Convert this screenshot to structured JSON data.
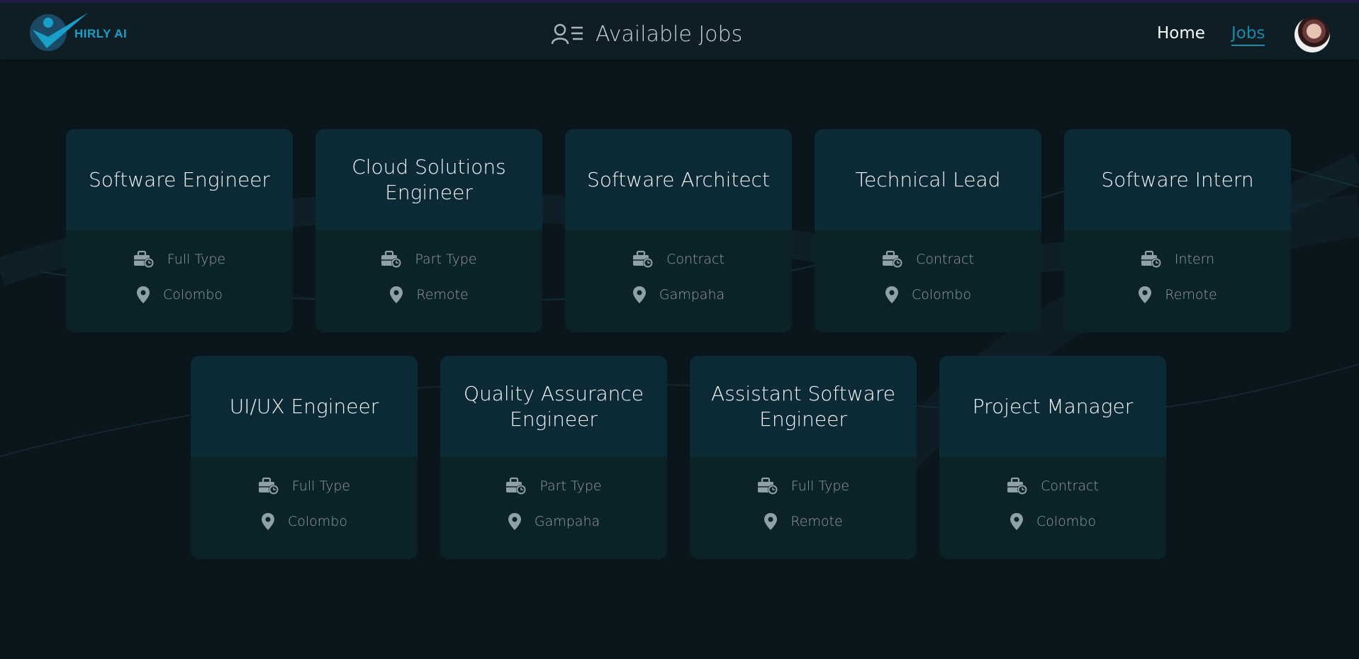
{
  "brand": {
    "name": "HIRLY AI"
  },
  "header": {
    "title": "Available Jobs",
    "title_icon": "user-list-icon"
  },
  "nav": {
    "home_label": "Home",
    "jobs_label": "Jobs"
  },
  "colors": {
    "accent": "#1b88a8",
    "background": "#0b161c",
    "card": "#0b2229",
    "card_header": "#0b2a35"
  },
  "jobs": [
    {
      "title": "Software Engineer",
      "type": "Full Type",
      "location": "Colombo"
    },
    {
      "title": "Cloud Solutions Engineer",
      "type": "Part Type",
      "location": "Remote"
    },
    {
      "title": "Software Architect",
      "type": "Contract",
      "location": "Gampaha"
    },
    {
      "title": "Technical Lead",
      "type": "Contract",
      "location": "Colombo"
    },
    {
      "title": "Software Intern",
      "type": "Intern",
      "location": "Remote"
    },
    {
      "title": "UI/UX Engineer",
      "type": "Full Type",
      "location": "Colombo"
    },
    {
      "title": "Quality Assurance Engineer",
      "type": "Part Type",
      "location": "Gampaha"
    },
    {
      "title": "Assistant Software Engineer",
      "type": "Full Type",
      "location": "Remote"
    },
    {
      "title": "Project Manager",
      "type": "Contract",
      "location": "Colombo"
    }
  ]
}
